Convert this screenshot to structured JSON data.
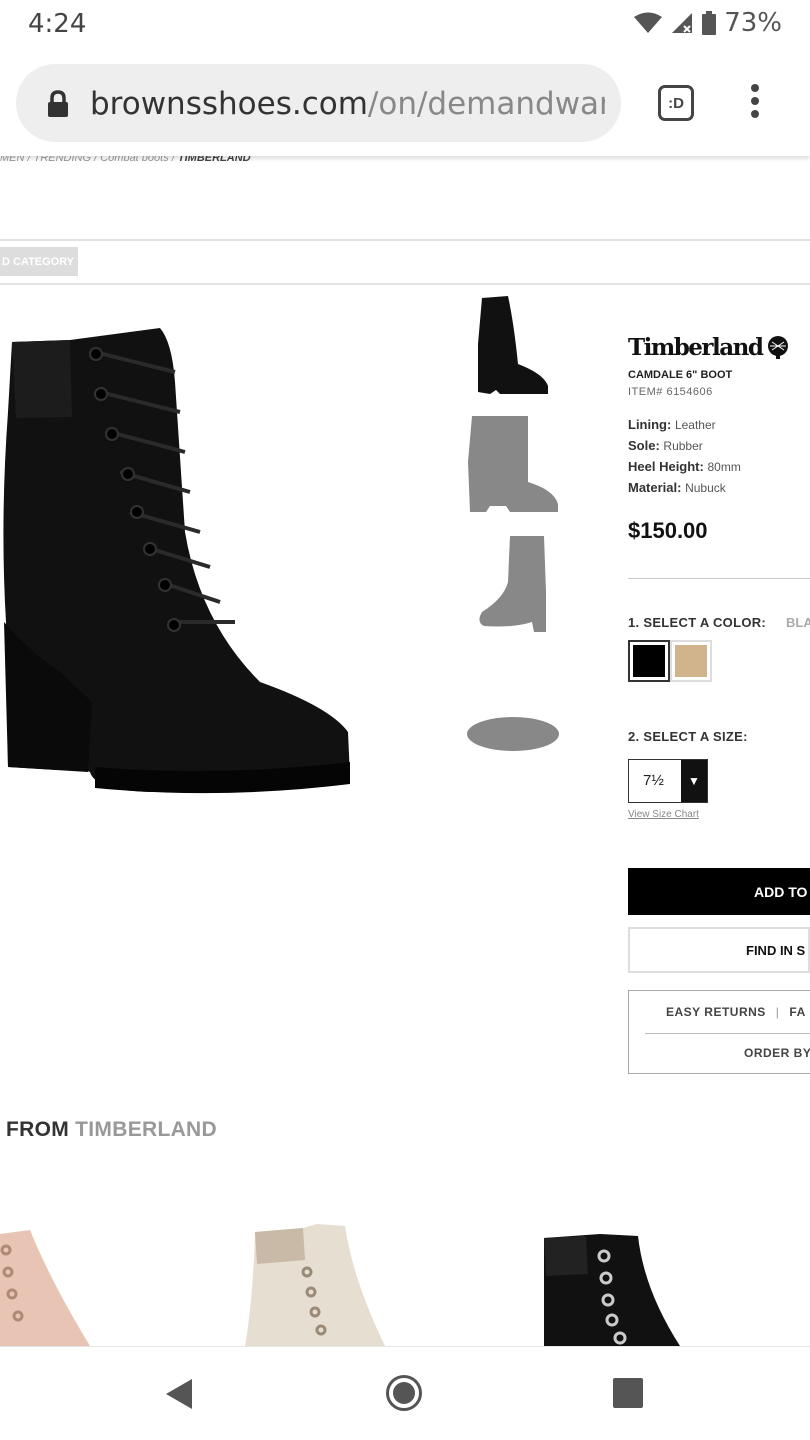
{
  "status_bar": {
    "time": "4:24",
    "battery": "73%"
  },
  "browser": {
    "url_host": "brownsshoes.com",
    "url_path": "/on/demandware.",
    "tab_label": ":D"
  },
  "breadcrumb": {
    "trail": "MEN / TRENDING / Combat boots / ",
    "current": "TIMBERLAND"
  },
  "category_button": "D CATEGORY",
  "product": {
    "brand": "Timberland",
    "name": "CAMDALE 6\" BOOT",
    "item": "ITEM# 6154606",
    "specs": [
      {
        "label": "Lining:",
        "value": "Leather"
      },
      {
        "label": "Sole:",
        "value": "Rubber"
      },
      {
        "label": "Heel Height:",
        "value": "80mm"
      },
      {
        "label": "Material:",
        "value": "Nubuck"
      }
    ],
    "price": "$150.00",
    "color_label": "1. SELECT A COLOR:",
    "color_value": "BLA",
    "colors": [
      "#000000",
      "#d2b48c"
    ],
    "size_label": "2. SELECT A SIZE:",
    "size_value": "7½",
    "size_chart": "View Size Chart",
    "add_to_cart": "ADD TO",
    "find_in_store": "FIND IN S",
    "easy_returns": "EASY RETURNS",
    "fast": "FA",
    "order_by": "ORDER BY"
  },
  "from_section": {
    "prefix": "FROM",
    "brand": "TIMBERLAND"
  }
}
